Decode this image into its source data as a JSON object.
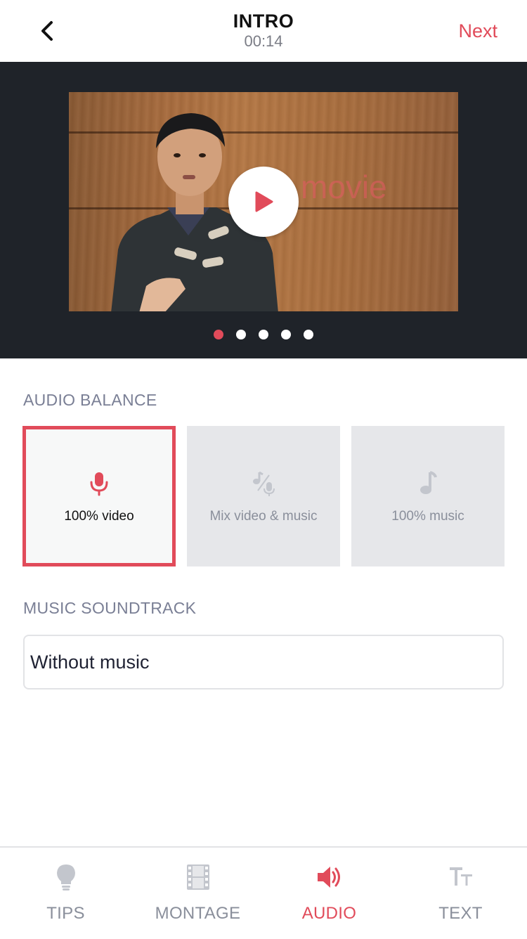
{
  "header": {
    "title": "INTRO",
    "duration": "00:14",
    "next_label": "Next",
    "back_icon": "chevron-left-icon"
  },
  "video": {
    "watermark_text": "movie",
    "play_icon": "play-icon",
    "page_count": 5,
    "active_page": 1
  },
  "audio_balance": {
    "title": "AUDIO BALANCE",
    "options": [
      {
        "label": "100% video",
        "icon": "microphone-icon",
        "selected": true
      },
      {
        "label": "Mix video & music",
        "icon": "music-mic-mix-icon",
        "selected": false
      },
      {
        "label": "100% music",
        "icon": "music-note-icon",
        "selected": false
      }
    ]
  },
  "music_soundtrack": {
    "title": "MUSIC SOUNDTRACK",
    "value": "Without music"
  },
  "tabbar": {
    "tabs": [
      {
        "label": "TIPS",
        "icon": "lightbulb-icon",
        "active": false
      },
      {
        "label": "MONTAGE",
        "icon": "film-strip-icon",
        "active": false
      },
      {
        "label": "AUDIO",
        "icon": "speaker-icon",
        "active": true
      },
      {
        "label": "TEXT",
        "icon": "text-size-icon",
        "active": false
      }
    ]
  },
  "colors": {
    "accent": "#e14b5a",
    "inactive": "#8a8f9b",
    "video_bg": "#1f2329",
    "card_bg": "#e6e7ea"
  }
}
